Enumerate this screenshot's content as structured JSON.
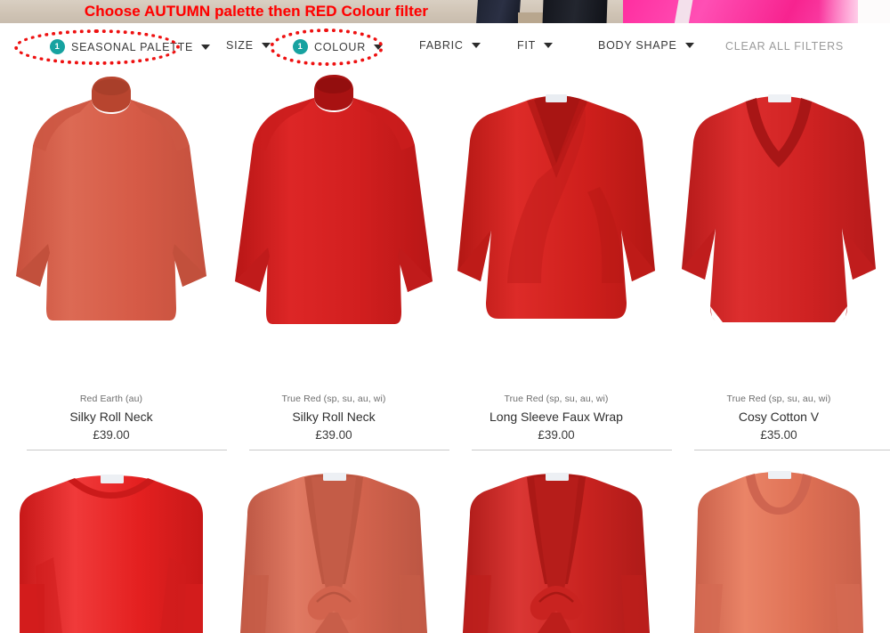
{
  "annotation": {
    "caption": "Choose AUTUMN palette then RED Colour filter",
    "caption_color": "#ff0000",
    "ellipse_color": "#ee1111",
    "targets": [
      "SEASONAL PALETTE",
      "COLOUR"
    ]
  },
  "filter_bar": {
    "badge_color": "#17a2a0",
    "items": [
      {
        "label": "SEASONAL PALETTE",
        "badge": "1",
        "has_caret": true
      },
      {
        "label": "SIZE",
        "badge": null,
        "has_caret": true
      },
      {
        "label": "COLOUR",
        "badge": "1",
        "has_caret": true
      },
      {
        "label": "FABRIC",
        "badge": null,
        "has_caret": true
      },
      {
        "label": "FIT",
        "badge": null,
        "has_caret": true
      },
      {
        "label": "BODY SHAPE",
        "badge": null,
        "has_caret": true
      }
    ],
    "clear_all": "CLEAR ALL FILTERS"
  },
  "products": [
    {
      "swatch": "Red Earth (au)",
      "name": "Silky Roll Neck",
      "price": "£39.00",
      "colors": {
        "main": "#d65b47",
        "shade": "#c04f3d",
        "light": "#e2705b"
      },
      "style": "rollneck"
    },
    {
      "swatch": "True Red (sp, su, au, wi)",
      "name": "Silky Roll Neck",
      "price": "£39.00",
      "colors": {
        "main": "#d21f1f",
        "shade": "#b81616",
        "light": "#e23030"
      },
      "style": "rollneck"
    },
    {
      "swatch": "True Red (sp, su, au, wi)",
      "name": "Long Sleeve Faux Wrap",
      "price": "£39.00",
      "colors": {
        "main": "#cf1f1c",
        "shade": "#b31714",
        "light": "#e03331"
      },
      "style": "wrap"
    },
    {
      "swatch": "True Red (sp, su, au, wi)",
      "name": "Cosy Cotton V",
      "price": "£35.00",
      "colors": {
        "main": "#cf2222",
        "shade": "#b51a1a",
        "light": "#de3838"
      },
      "style": "vneck"
    },
    {
      "swatch": null,
      "name": null,
      "price": null,
      "colors": {
        "main": "#e42020",
        "shade": "#c71818",
        "light": "#f03a3a"
      },
      "style": "boatneck"
    },
    {
      "swatch": null,
      "name": null,
      "price": null,
      "colors": {
        "main": "#d2634d",
        "shade": "#bb5542",
        "light": "#e07a63"
      },
      "style": "tiefront"
    },
    {
      "swatch": null,
      "name": null,
      "price": null,
      "colors": {
        "main": "#c92320",
        "shade": "#ad1a18",
        "light": "#da3734"
      },
      "style": "tiefront"
    },
    {
      "swatch": null,
      "name": null,
      "price": null,
      "colors": {
        "main": "#de7054",
        "shade": "#c9604a",
        "light": "#ea8467"
      },
      "style": "scoop"
    }
  ]
}
